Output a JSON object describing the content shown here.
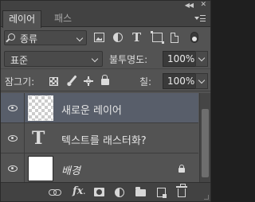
{
  "tabs": [
    {
      "label": "레이어",
      "active": true
    },
    {
      "label": "패스",
      "active": false
    }
  ],
  "filter": {
    "kind_label": "종류",
    "icons": [
      "pixel-filter-icon",
      "adjustment-filter-icon",
      "type-filter-icon",
      "shape-filter-icon",
      "smart-object-filter-icon"
    ]
  },
  "blend": {
    "mode": "표준",
    "opacity_label": "불투명도:",
    "opacity_value": "100%"
  },
  "lock": {
    "label": "잠그기:",
    "fill_label": "칠:",
    "fill_value": "100%"
  },
  "layers": [
    {
      "name": "새로운 레이어",
      "type": "pixel",
      "selected": true,
      "visible": true
    },
    {
      "name": "텍스트를 래스터화?",
      "type": "text",
      "selected": false,
      "visible": true
    },
    {
      "name": "배경",
      "type": "background",
      "selected": false,
      "visible": true,
      "locked": true
    }
  ],
  "colors": {
    "panel": "#535353",
    "selected_row": "#585e6a",
    "tab_bar": "#424242"
  }
}
